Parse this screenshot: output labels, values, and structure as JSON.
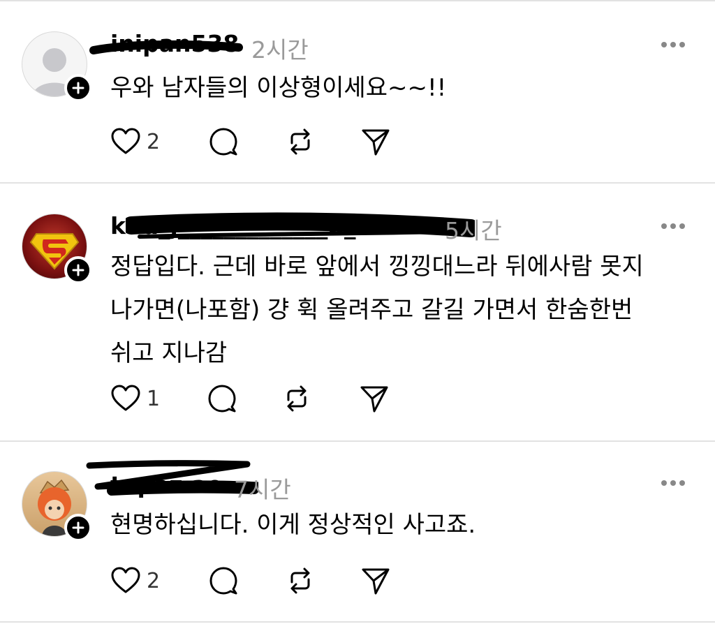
{
  "comments": [
    {
      "username": "inipan538",
      "time": "2시간",
      "text": "우와 남자들의 이상형이세요~~!!",
      "likes": "2",
      "avatar_icon": "default-user-avatar-icon"
    },
    {
      "username": "kdu_j_____________b_soul",
      "time": "5시간",
      "text": "정답입다. 근데 바로 앞에서 낑낑대느라 뒤에사람 못지\n나가면(나포함) 걍 휙 올려주고 갈길 가면서 한숨한번\n쉬고 지나감",
      "likes": "1",
      "avatar_icon": "superman-logo-avatar"
    },
    {
      "username": "topaz.ae",
      "time": "7시간",
      "text": "현명하십니다. 이게 정상적인 사고죠.",
      "likes": "2",
      "avatar_icon": "figure-photo-avatar"
    }
  ],
  "icons": {
    "like": "heart-icon",
    "reply": "speech-bubble-icon",
    "repost": "repost-icon",
    "share": "send-icon",
    "more": "more-dots-icon",
    "follow": "plus-icon"
  },
  "colors": {
    "secondary_text": "#9a9a9a",
    "divider": "#e2e2e2"
  }
}
